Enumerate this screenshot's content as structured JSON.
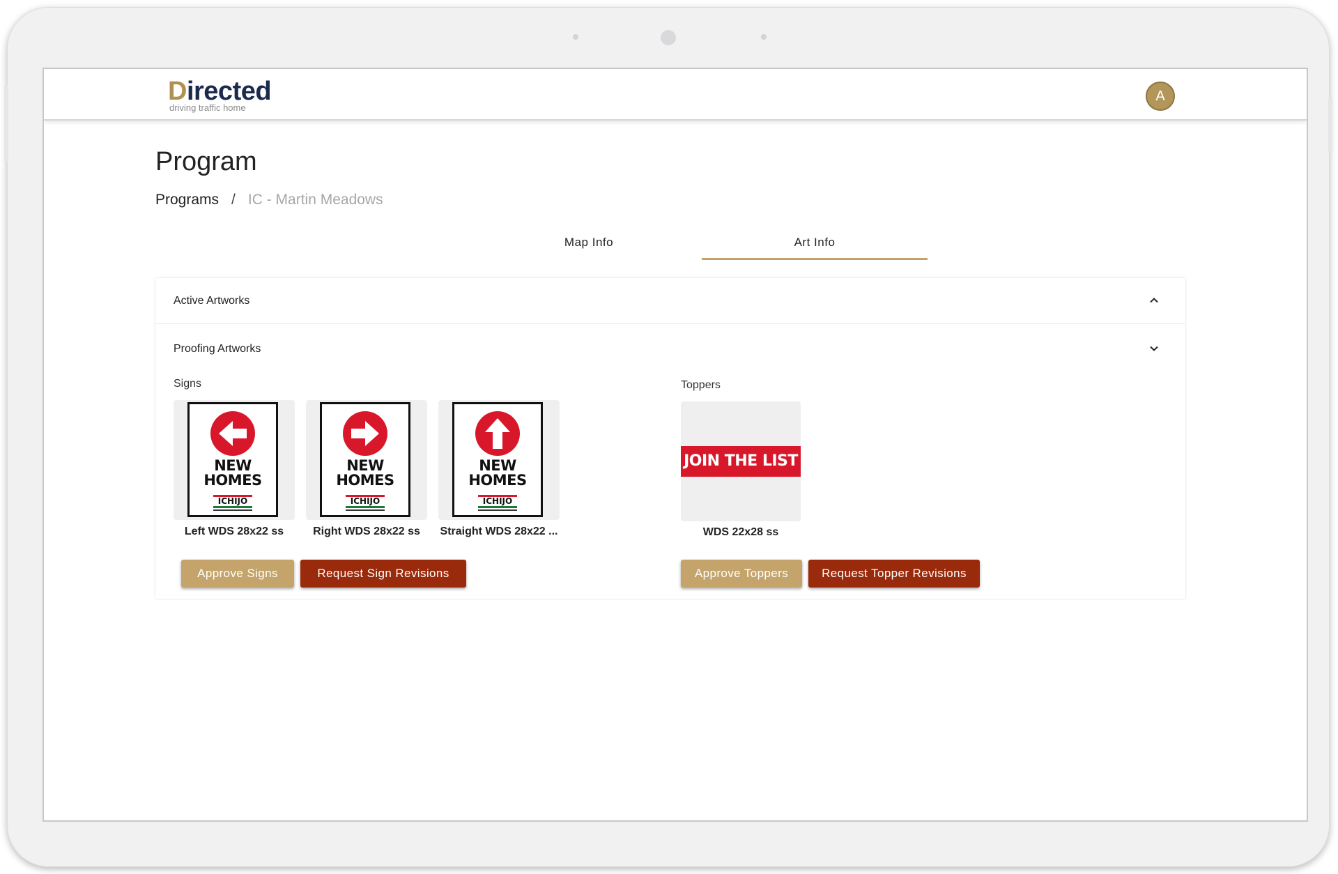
{
  "header": {
    "logo_text_first": "D",
    "logo_text_rest": "irected",
    "logo_tagline": "driving traffic home",
    "avatar_initial": "A"
  },
  "page": {
    "title": "Program"
  },
  "breadcrumb": {
    "root": "Programs",
    "separator": "/",
    "current": "IC - Martin Meadows"
  },
  "tabs": [
    {
      "label": "Map Info",
      "active": false
    },
    {
      "label": "Art Info",
      "active": true
    }
  ],
  "accordion": {
    "active_artworks": {
      "label": "Active Artworks",
      "expanded": false,
      "icon": "chevron-up-icon"
    },
    "proofing_artworks": {
      "label": "Proofing Artworks",
      "expanded": true,
      "icon": "chevron-down-icon"
    }
  },
  "signs": {
    "label": "Signs",
    "items": [
      {
        "caption": "Left WDS 28x22 ss",
        "arrow": "left",
        "line1": "NEW",
        "line2": "HOMES",
        "brand": "ICHIJO"
      },
      {
        "caption": "Right WDS 28x22 ss",
        "arrow": "right",
        "line1": "NEW",
        "line2": "HOMES",
        "brand": "ICHIJO"
      },
      {
        "caption": "Straight WDS 28x22 ...",
        "arrow": "up",
        "line1": "NEW",
        "line2": "HOMES",
        "brand": "ICHIJO"
      }
    ],
    "approve_label": "Approve Signs",
    "revise_label": "Request Sign Revisions"
  },
  "toppers": {
    "label": "Toppers",
    "items": [
      {
        "caption": "WDS 22x28 ss",
        "banner": "JOIN THE LIST"
      }
    ],
    "approve_label": "Approve Toppers",
    "revise_label": "Request Topper Revisions"
  },
  "colors": {
    "brand_gold": "#c4a46b",
    "brand_navy": "#1c2b4d",
    "action_brick": "#9a2a0c",
    "sign_red": "#d8182a"
  }
}
